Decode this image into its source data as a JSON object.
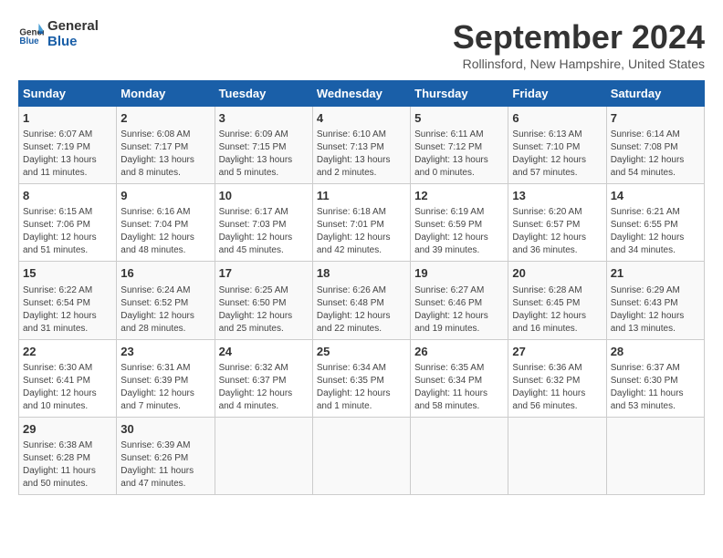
{
  "header": {
    "logo_line1": "General",
    "logo_line2": "Blue",
    "title": "September 2024",
    "subtitle": "Rollinsford, New Hampshire, United States"
  },
  "weekdays": [
    "Sunday",
    "Monday",
    "Tuesday",
    "Wednesday",
    "Thursday",
    "Friday",
    "Saturday"
  ],
  "weeks": [
    [
      {
        "day": "1",
        "sunrise": "6:07 AM",
        "sunset": "7:19 PM",
        "daylight": "13 hours and 11 minutes."
      },
      {
        "day": "2",
        "sunrise": "6:08 AM",
        "sunset": "7:17 PM",
        "daylight": "13 hours and 8 minutes."
      },
      {
        "day": "3",
        "sunrise": "6:09 AM",
        "sunset": "7:15 PM",
        "daylight": "13 hours and 5 minutes."
      },
      {
        "day": "4",
        "sunrise": "6:10 AM",
        "sunset": "7:13 PM",
        "daylight": "13 hours and 2 minutes."
      },
      {
        "day": "5",
        "sunrise": "6:11 AM",
        "sunset": "7:12 PM",
        "daylight": "13 hours and 0 minutes."
      },
      {
        "day": "6",
        "sunrise": "6:13 AM",
        "sunset": "7:10 PM",
        "daylight": "12 hours and 57 minutes."
      },
      {
        "day": "7",
        "sunrise": "6:14 AM",
        "sunset": "7:08 PM",
        "daylight": "12 hours and 54 minutes."
      }
    ],
    [
      {
        "day": "8",
        "sunrise": "6:15 AM",
        "sunset": "7:06 PM",
        "daylight": "12 hours and 51 minutes."
      },
      {
        "day": "9",
        "sunrise": "6:16 AM",
        "sunset": "7:04 PM",
        "daylight": "12 hours and 48 minutes."
      },
      {
        "day": "10",
        "sunrise": "6:17 AM",
        "sunset": "7:03 PM",
        "daylight": "12 hours and 45 minutes."
      },
      {
        "day": "11",
        "sunrise": "6:18 AM",
        "sunset": "7:01 PM",
        "daylight": "12 hours and 42 minutes."
      },
      {
        "day": "12",
        "sunrise": "6:19 AM",
        "sunset": "6:59 PM",
        "daylight": "12 hours and 39 minutes."
      },
      {
        "day": "13",
        "sunrise": "6:20 AM",
        "sunset": "6:57 PM",
        "daylight": "12 hours and 36 minutes."
      },
      {
        "day": "14",
        "sunrise": "6:21 AM",
        "sunset": "6:55 PM",
        "daylight": "12 hours and 34 minutes."
      }
    ],
    [
      {
        "day": "15",
        "sunrise": "6:22 AM",
        "sunset": "6:54 PM",
        "daylight": "12 hours and 31 minutes."
      },
      {
        "day": "16",
        "sunrise": "6:24 AM",
        "sunset": "6:52 PM",
        "daylight": "12 hours and 28 minutes."
      },
      {
        "day": "17",
        "sunrise": "6:25 AM",
        "sunset": "6:50 PM",
        "daylight": "12 hours and 25 minutes."
      },
      {
        "day": "18",
        "sunrise": "6:26 AM",
        "sunset": "6:48 PM",
        "daylight": "12 hours and 22 minutes."
      },
      {
        "day": "19",
        "sunrise": "6:27 AM",
        "sunset": "6:46 PM",
        "daylight": "12 hours and 19 minutes."
      },
      {
        "day": "20",
        "sunrise": "6:28 AM",
        "sunset": "6:45 PM",
        "daylight": "12 hours and 16 minutes."
      },
      {
        "day": "21",
        "sunrise": "6:29 AM",
        "sunset": "6:43 PM",
        "daylight": "12 hours and 13 minutes."
      }
    ],
    [
      {
        "day": "22",
        "sunrise": "6:30 AM",
        "sunset": "6:41 PM",
        "daylight": "12 hours and 10 minutes."
      },
      {
        "day": "23",
        "sunrise": "6:31 AM",
        "sunset": "6:39 PM",
        "daylight": "12 hours and 7 minutes."
      },
      {
        "day": "24",
        "sunrise": "6:32 AM",
        "sunset": "6:37 PM",
        "daylight": "12 hours and 4 minutes."
      },
      {
        "day": "25",
        "sunrise": "6:34 AM",
        "sunset": "6:35 PM",
        "daylight": "12 hours and 1 minute."
      },
      {
        "day": "26",
        "sunrise": "6:35 AM",
        "sunset": "6:34 PM",
        "daylight": "11 hours and 58 minutes."
      },
      {
        "day": "27",
        "sunrise": "6:36 AM",
        "sunset": "6:32 PM",
        "daylight": "11 hours and 56 minutes."
      },
      {
        "day": "28",
        "sunrise": "6:37 AM",
        "sunset": "6:30 PM",
        "daylight": "11 hours and 53 minutes."
      }
    ],
    [
      {
        "day": "29",
        "sunrise": "6:38 AM",
        "sunset": "6:28 PM",
        "daylight": "11 hours and 50 minutes."
      },
      {
        "day": "30",
        "sunrise": "6:39 AM",
        "sunset": "6:26 PM",
        "daylight": "11 hours and 47 minutes."
      },
      null,
      null,
      null,
      null,
      null
    ]
  ],
  "labels": {
    "sunrise": "Sunrise:",
    "sunset": "Sunset:",
    "daylight": "Daylight:"
  }
}
